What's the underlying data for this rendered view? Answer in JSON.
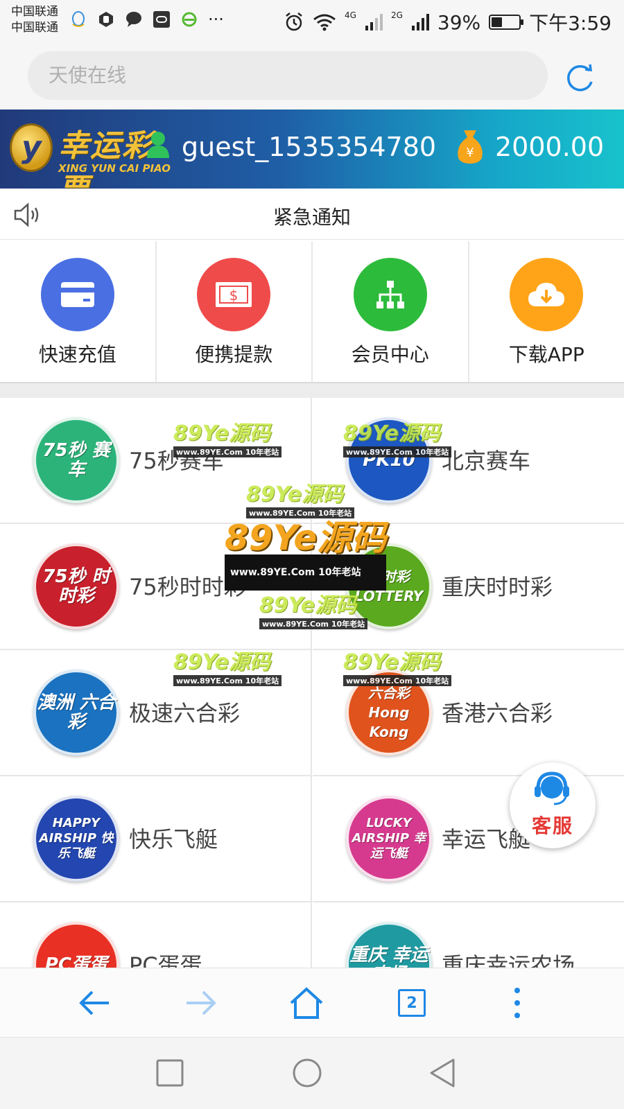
{
  "status_bar": {
    "carrier_1": "中国联通",
    "carrier_2": "中国联通",
    "more": "···",
    "net_1": "4G",
    "net_2": "2G",
    "battery": "39%",
    "time": "下午3:59"
  },
  "address_bar": {
    "search_text": "天使在线"
  },
  "header": {
    "logo_cn": "幸运彩票",
    "logo_en": "XING YUN CAI PIAO",
    "username": "guest_1535354780",
    "balance": "2000.00"
  },
  "notice": {
    "text": "紧急通知"
  },
  "quick_actions": [
    {
      "label": "快速充值",
      "icon": "card-icon",
      "color": "#4a6fe3"
    },
    {
      "label": "便携提款",
      "icon": "cash-icon",
      "color": "#ef4b4b"
    },
    {
      "label": "会员中心",
      "icon": "org-icon",
      "color": "#2dbb3c"
    },
    {
      "label": "下载APP",
      "icon": "cloud-download-icon",
      "color": "#ffa418"
    }
  ],
  "games": [
    {
      "name": "75秒赛车",
      "badge": "75秒 赛车",
      "color": "#2bb37a"
    },
    {
      "name": "北京赛车",
      "badge": "PK10",
      "color": "#1d58c2"
    },
    {
      "name": "75秒时时彩",
      "badge": "75秒 时时彩",
      "color": "#c8202c"
    },
    {
      "name": "重庆时时彩",
      "badge": "时时彩 LOTTERY",
      "color": "#5aa91f"
    },
    {
      "name": "极速六合彩",
      "badge": "澳洲 六合彩",
      "color": "#1a72c0"
    },
    {
      "name": "香港六合彩",
      "badge": "六合彩 Hong Kong",
      "color": "#e0531c"
    },
    {
      "name": "快乐飞艇",
      "badge": "HAPPY AIRSHIP 快乐飞艇",
      "color": "#2346b0"
    },
    {
      "name": "幸运飞艇",
      "badge": "LUCKY AIRSHIP 幸运飞艇",
      "color": "#d63a8e"
    },
    {
      "name": "PC蛋蛋",
      "badge": "PC蛋蛋",
      "color": "#e83024"
    },
    {
      "name": "重庆幸运农场",
      "badge": "重庆 幸运农场",
      "color": "#1f9aa0"
    }
  ],
  "watermark": {
    "text": "89Ye源码",
    "sub": "www.89YE.Com 10年老站"
  },
  "customer_service": {
    "label": "客服"
  },
  "toolbar": {
    "tab_count": "2"
  },
  "colors": {
    "accent": "#1e88e5",
    "banner_start": "#213a7a",
    "banner_end": "#18c2cc"
  }
}
